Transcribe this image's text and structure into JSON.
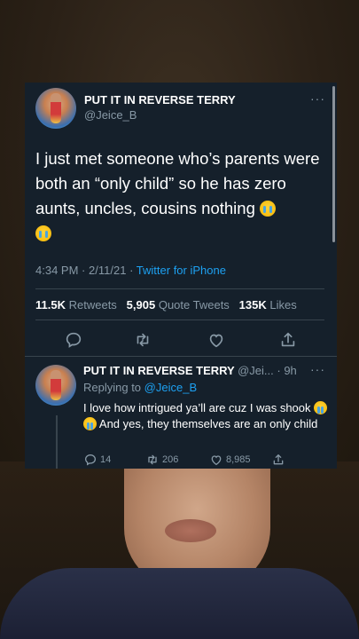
{
  "tweet": {
    "display_name": "PUT IT IN REVERSE TERRY",
    "handle": "@Jeice_B",
    "text": "I just met someone who’s parents were both an “only child” so he has zero aunts, uncles, cousins nothing",
    "time": "4:34 PM",
    "date": "2/11/21",
    "separator": "·",
    "source": "Twitter for iPhone",
    "stats": {
      "retweets_count": "11.5K",
      "retweets_label": "Retweets",
      "quote_count": "5,905",
      "quote_label": "Quote Tweets",
      "likes_count": "135K",
      "likes_label": "Likes"
    },
    "more": "···"
  },
  "reply": {
    "display_name": "PUT IT IN REVERSE TERRY",
    "handle_time": "@Jei... · 9h",
    "replying_prefix": "Replying to",
    "replying_handle": "@Jeice_B",
    "text_part1": "I love how intrigued ya’ll are cuz I was shook",
    "text_part2": "And yes, they themselves are an only child",
    "more": "···",
    "counts": {
      "replies": "14",
      "retweets": "206",
      "likes": "8,985"
    }
  },
  "icons": {
    "reply": "reply-icon",
    "retweet": "retweet-icon",
    "like": "heart-icon",
    "share": "share-icon",
    "emoji": "loudly-crying-face-emoji"
  },
  "colors": {
    "card_bg": "#15202b",
    "text": "#ffffff",
    "muted": "#8899a6",
    "link": "#1da1f2",
    "divider": "#38444d"
  }
}
